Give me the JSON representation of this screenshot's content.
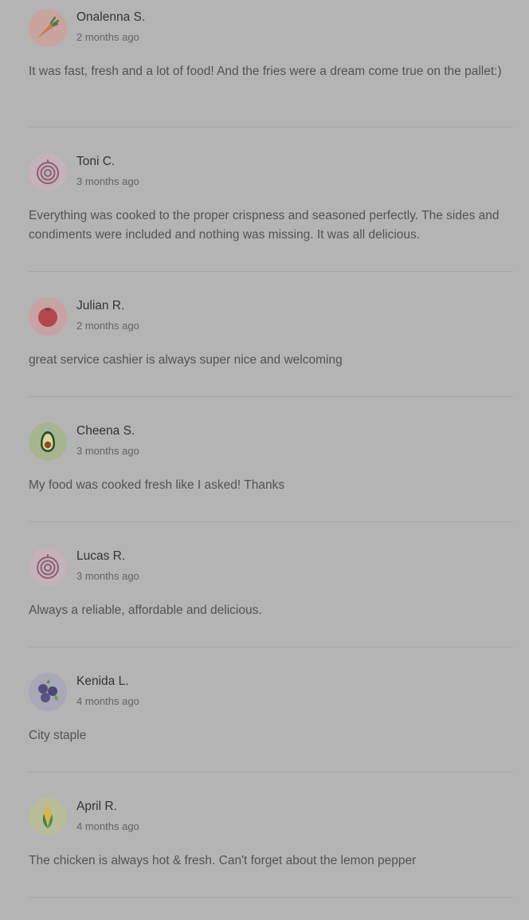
{
  "reviews": [
    {
      "name": "Onalenna S.",
      "date": "2 months ago",
      "text": "It was fast, fresh and a lot of food! And the fries were a dream come true on the pallet:)",
      "avatar_icon": "carrot-icon",
      "avatar_bg": "#c9a49e"
    },
    {
      "name": "Toni C.",
      "date": "3 months ago",
      "text": "Everything was cooked to the proper crispness and seasoned perfectly. The sides and condiments were included and nothing was missing. It was all delicious.",
      "avatar_icon": "onion-icon",
      "avatar_bg": "#c4b2ba"
    },
    {
      "name": "Julian R.",
      "date": "2 months ago",
      "text": "great service cashier is always super nice and welcoming",
      "avatar_icon": "tomato-icon",
      "avatar_bg": "#c8a2a4"
    },
    {
      "name": "Cheena S.",
      "date": "3 months ago",
      "text": "My food was cooked fresh like I asked! Thanks",
      "avatar_icon": "avocado-icon",
      "avatar_bg": "#a5b590"
    },
    {
      "name": "Lucas R.",
      "date": "3 months ago",
      "text": "Always a reliable, affordable and delicious.",
      "avatar_icon": "onion-icon",
      "avatar_bg": "#c4b2ba"
    },
    {
      "name": "Kenida L.",
      "date": "4 months ago",
      "text": "City staple",
      "avatar_icon": "blueberry-icon",
      "avatar_bg": "#a8a8b6"
    },
    {
      "name": "April R.",
      "date": "4 months ago",
      "text": "The chicken is always hot & fresh. Can't forget about the lemon pepper",
      "avatar_icon": "corn-icon",
      "avatar_bg": "#b9bc9a"
    }
  ]
}
